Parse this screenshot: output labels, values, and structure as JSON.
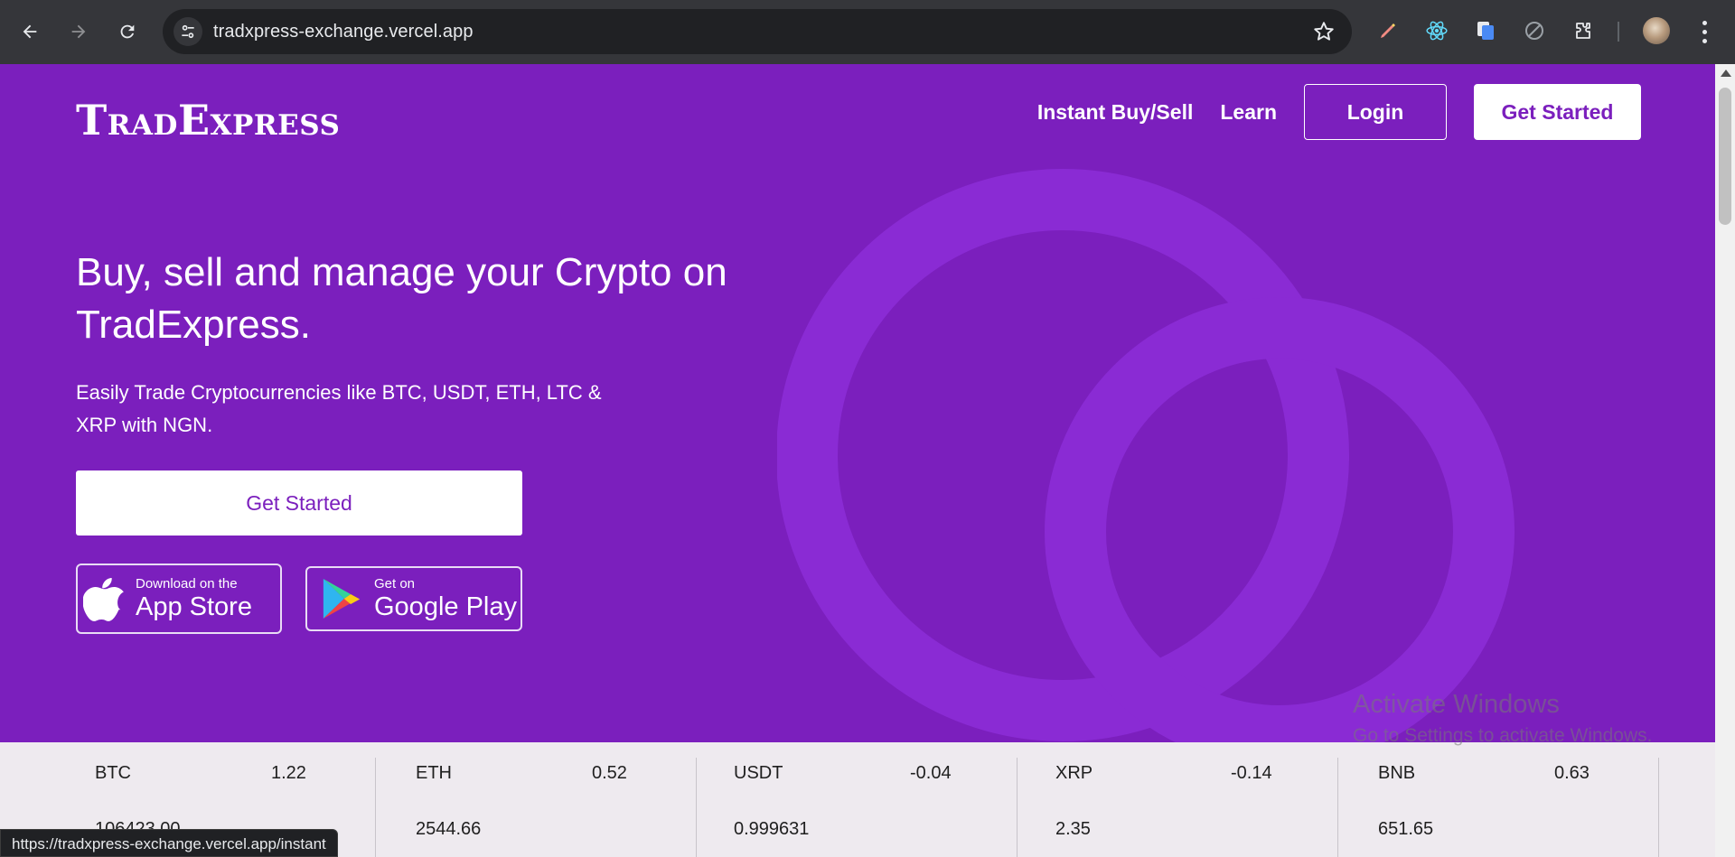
{
  "browser": {
    "url": "tradxpress-exchange.vercel.app",
    "status_url": "https://tradxpress-exchange.vercel.app/instant"
  },
  "logo": {
    "part1_big": "T",
    "part1_small": "RAD",
    "part2_big": "E",
    "part2_small": "XPRESS"
  },
  "nav": {
    "instant": "Instant Buy/Sell",
    "learn": "Learn",
    "login": "Login",
    "get_started": "Get Started"
  },
  "hero": {
    "title": "Buy, sell and manage your Crypto on TradExpress.",
    "subtitle": "Easily Trade Cryptocurrencies like BTC, USDT, ETH, LTC & XRP with NGN.",
    "cta": "Get Started"
  },
  "stores": {
    "apple_line1": "Download on the",
    "apple_line2": "App Store",
    "google_line1": "Get on",
    "google_line2": "Google Play"
  },
  "ticker": [
    {
      "symbol": "BTC",
      "change": "1.22",
      "price": "106423.00"
    },
    {
      "symbol": "ETH",
      "change": "0.52",
      "price": "2544.66"
    },
    {
      "symbol": "USDT",
      "change": "-0.04",
      "price": "0.999631"
    },
    {
      "symbol": "XRP",
      "change": "-0.14",
      "price": "2.35"
    },
    {
      "symbol": "BNB",
      "change": "0.63",
      "price": "651.65"
    }
  ],
  "watermark": {
    "line1": "Activate Windows",
    "line2": "Go to Settings to activate Windows."
  },
  "colors": {
    "brand_purple": "#7b1fbd",
    "ring_purple": "#8a2bd4",
    "ticker_bg": "#eeeaef"
  }
}
